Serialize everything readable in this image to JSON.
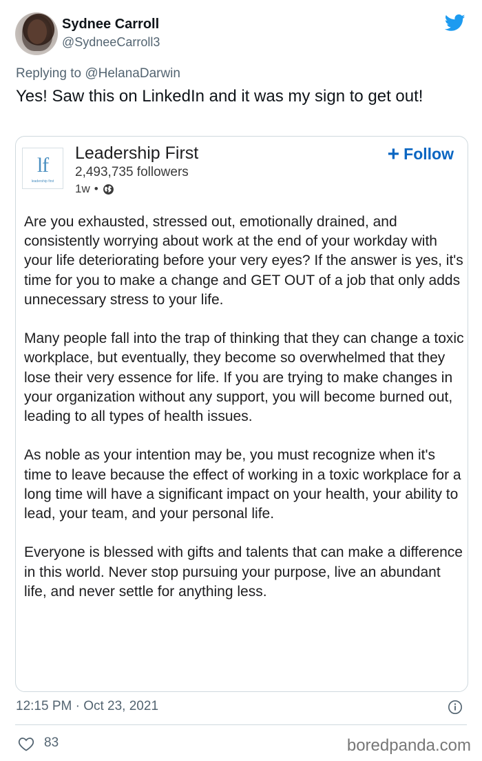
{
  "author": {
    "name": "Sydnee Carroll",
    "handle": "@SydneeCarroll3"
  },
  "reply": {
    "prefix": "Replying to ",
    "mention": "@HelanaDarwin"
  },
  "tweet": {
    "text": "Yes! Saw this on LinkedIn and it was my sign to get out!"
  },
  "linkedin_card": {
    "logo_mark": "lf",
    "logo_small": "leadership first",
    "company": "Leadership First",
    "followers": "2,493,735 followers",
    "age": "1w",
    "separator": "•",
    "follow_plus": "+",
    "follow_label": "Follow",
    "paragraphs": [
      "Are you exhausted, stressed out, emotionally drained, and consistently worrying about work at the end of your workday with your life deteriorating before your very eyes? If the answer is yes, it's time for you to make a change and GET OUT of a job that only adds unnecessary stress to your life.",
      "Many people fall into the trap of thinking that they can change a toxic workplace, but eventually, they become so overwhelmed that they lose their very essence for life. If you are trying to make changes in your organization without any support, you will become burned out, leading to all types of health issues.",
      "As noble as your intention may be, you must recognize when it's time to leave because the effect of working in a toxic workplace for a long time will have a significant impact on your health, your ability to lead, your team, and your personal life.",
      "Everyone is blessed with gifts and talents that can make a difference in this world. Never stop pursuing your purpose, live an abundant life, and never settle for anything less."
    ]
  },
  "footer": {
    "timestamp": "12:15 PM · Oct 23, 2021",
    "likes": "83",
    "watermark": "boredpanda.com"
  },
  "colors": {
    "twitter_blue": "#1d9bf0",
    "linkedin_blue": "#0a66c2",
    "muted": "#536471"
  },
  "icons": [
    "twitter-bird-icon",
    "globe-icon",
    "info-icon",
    "heart-icon"
  ]
}
